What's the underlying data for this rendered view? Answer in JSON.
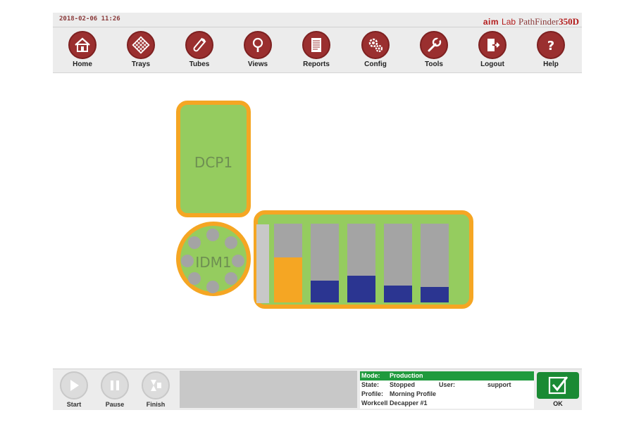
{
  "header": {
    "datetime": "2018-02-06 11:26",
    "brand_aim": "aim",
    "brand_lab": "Lab",
    "brand_product": "PathFinder",
    "brand_model": "350D"
  },
  "toolbar": {
    "items": [
      {
        "label": "Home",
        "icon": "home-icon"
      },
      {
        "label": "Trays",
        "icon": "tray-grid-icon"
      },
      {
        "label": "Tubes",
        "icon": "tube-icon"
      },
      {
        "label": "Views",
        "icon": "magnifier-icon"
      },
      {
        "label": "Reports",
        "icon": "document-icon"
      },
      {
        "label": "Config",
        "icon": "gears-icon"
      },
      {
        "label": "Tools",
        "icon": "wrench-icon"
      },
      {
        "label": "Logout",
        "icon": "logout-icon"
      },
      {
        "label": "Help",
        "icon": "question-icon"
      }
    ]
  },
  "workcell": {
    "dcp_label": "DCP1",
    "idm_label": "IDM1",
    "rack_slots": [
      {
        "fill_fraction": 0.57,
        "color": "#f5a623"
      },
      {
        "fill_fraction": 0.28,
        "color": "#2b3591"
      },
      {
        "fill_fraction": 0.34,
        "color": "#2b3591"
      },
      {
        "fill_fraction": 0.21,
        "color": "#2b3591"
      },
      {
        "fill_fraction": 0.2,
        "color": "#2b3591"
      }
    ],
    "colors": {
      "module_green": "#95cc5f",
      "module_border": "#f5a623",
      "slot_gray": "#a4a4a4"
    }
  },
  "controls": {
    "start_label": "Start",
    "pause_label": "Pause",
    "finish_label": "Finish",
    "message": ""
  },
  "status": {
    "mode_label": "Mode:",
    "mode_value": "Production",
    "state_label": "State:",
    "state_value": "Stopped",
    "user_label": "User:",
    "user_value": "support",
    "profile_label": "Profile:",
    "profile_value": "Morning Profile",
    "workcell_label": "Workcell",
    "workcell_value": "Decapper #1",
    "mode_color": "#1f9a3d"
  },
  "ok": {
    "label": "OK",
    "color": "#1a8a34"
  }
}
